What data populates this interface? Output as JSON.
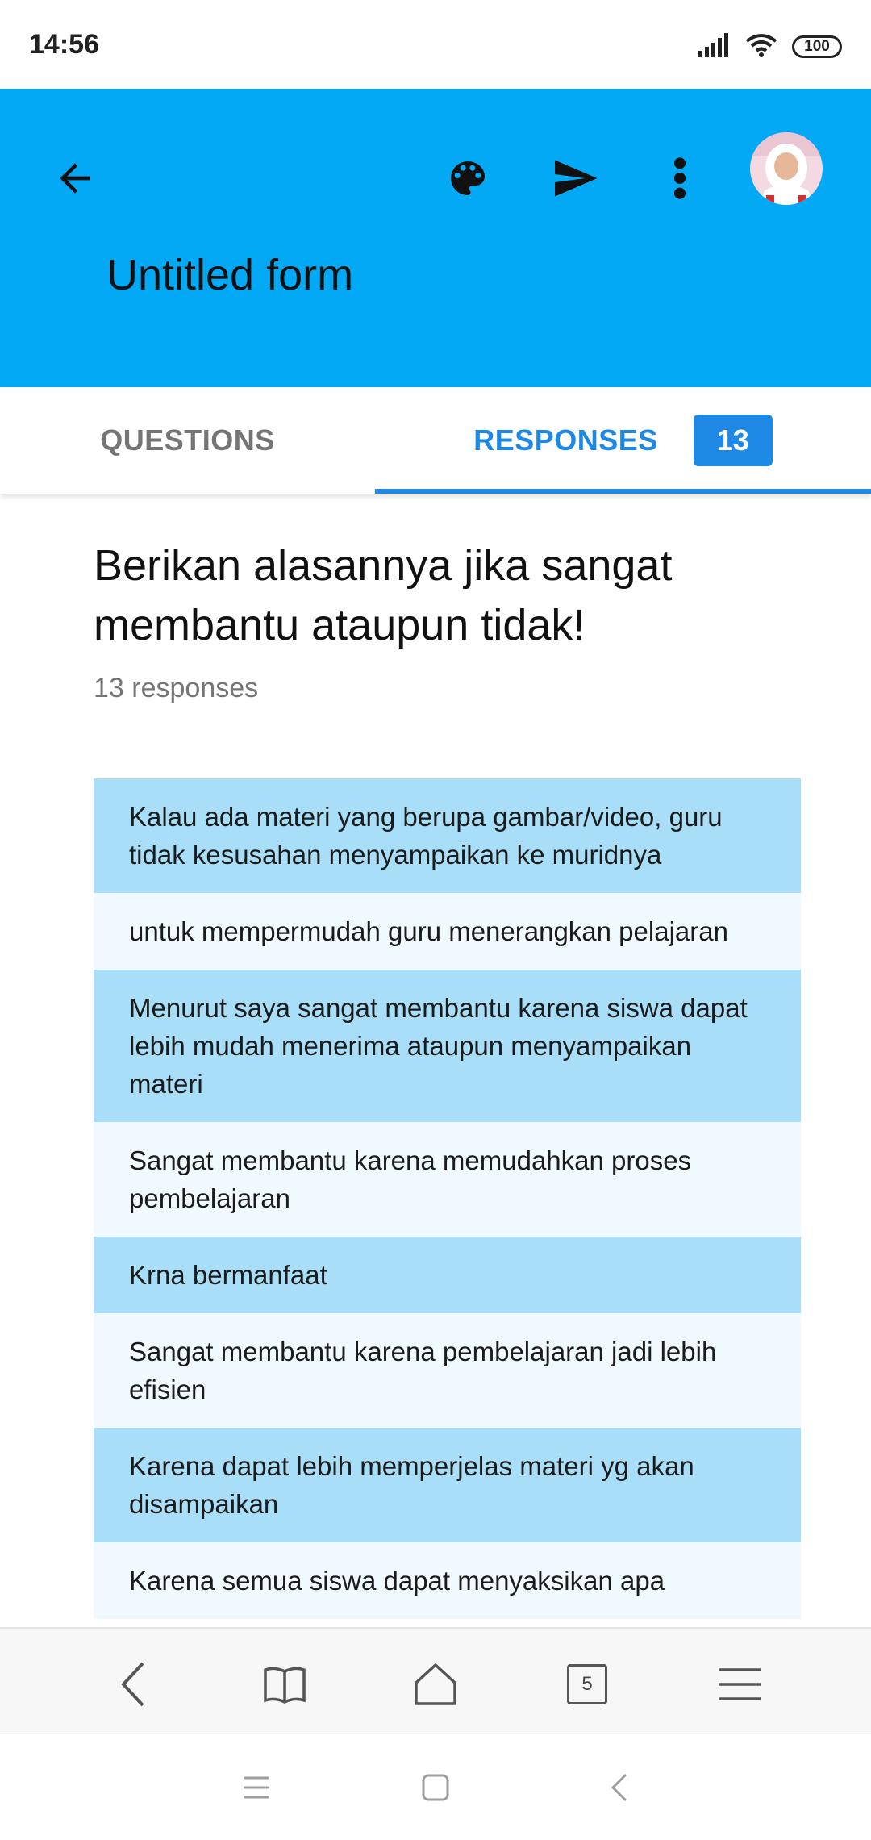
{
  "status_bar": {
    "time": "14:56",
    "battery": "100"
  },
  "header": {
    "title": "Untitled form"
  },
  "tabs": {
    "questions_label": "QUESTIONS",
    "responses_label": "RESPONSES",
    "responses_count": "13"
  },
  "question": {
    "title": "Berikan alasannya jika sangat membantu ataupun tidak!",
    "count_text": "13 responses"
  },
  "responses": [
    "Kalau ada materi yang berupa gambar/video, guru tidak kesusahan menyampaikan ke muridnya",
    "untuk mempermudah guru menerangkan pelajaran",
    "Menurut saya sangat membantu karena siswa dapat lebih mudah menerima ataupun menyampaikan materi",
    "Sangat membantu karena memudahkan proses pembelajaran",
    "Krna bermanfaat",
    "Sangat membantu karena pembelajaran jadi lebih efisien",
    "Karena dapat lebih memperjelas materi yg akan disampaikan",
    "Karena semua siswa dapat menyaksikan apa"
  ],
  "browser_bar": {
    "tab_count": "5"
  },
  "colors": {
    "header": "#03a9f4",
    "accent": "#1e88e5",
    "row_dark": "#a8def8",
    "row_light": "#f0f9fe"
  }
}
